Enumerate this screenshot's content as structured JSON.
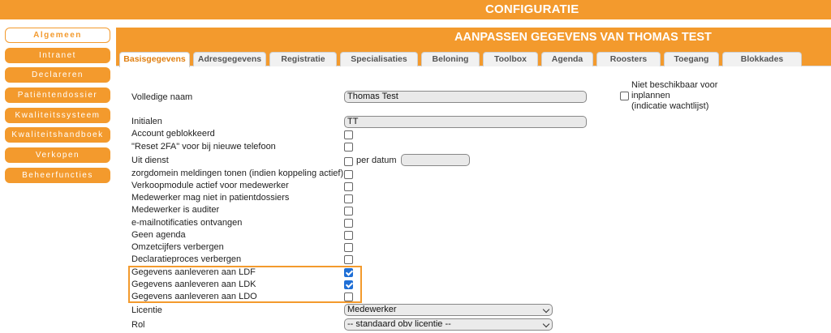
{
  "topbar": {
    "title": "CONFIGURATIE"
  },
  "sidebar": {
    "items": [
      {
        "label": "Algemeen",
        "active": true
      },
      {
        "label": "Intranet"
      },
      {
        "label": "Declareren"
      },
      {
        "label": "Patiëntendossier"
      },
      {
        "label": "Kwaliteitssysteem"
      },
      {
        "label": "Kwaliteitshandboek"
      },
      {
        "label": "Verkopen"
      },
      {
        "label": "Beheerfuncties"
      }
    ]
  },
  "header": {
    "title": "AANPASSEN GEGEVENS VAN THOMAS TEST"
  },
  "tabs": [
    {
      "label": "Basisgegevens",
      "active": true
    },
    {
      "label": "Adresgegevens"
    },
    {
      "label": "Registratie"
    },
    {
      "label": "Specialisaties"
    },
    {
      "label": "Beloning"
    },
    {
      "label": "Toolbox"
    },
    {
      "label": "Agenda"
    },
    {
      "label": "Roosters"
    },
    {
      "label": "Toegang"
    },
    {
      "label": "Blokkades"
    }
  ],
  "form": {
    "volledige_naam": {
      "label": "Volledige naam",
      "value": "Thomas Test"
    },
    "initialen": {
      "label": "Initialen",
      "value": "TT"
    },
    "not_available": {
      "label_1": "Niet beschikbaar voor",
      "label_2": "inplannen",
      "label_3": "(indicatie wachtlijst)",
      "checked": false
    },
    "uit_dienst": {
      "label": "Uit dienst",
      "per_datum_label": "per datum",
      "per_datum_value": ""
    },
    "checkboxes": [
      {
        "label": "Account geblokkeerd",
        "checked": false
      },
      {
        "label": "\"Reset 2FA\" voor bij nieuwe telefoon",
        "checked": false
      },
      {
        "label": "zorgdomein meldingen tonen (indien koppeling actief)",
        "checked": false
      },
      {
        "label": "Verkoopmodule actief voor medewerker",
        "checked": false
      },
      {
        "label": "Medewerker mag niet in patientdossiers",
        "checked": false
      },
      {
        "label": "Medewerker is auditer",
        "checked": false
      },
      {
        "label": "e-mailnotificaties ontvangen",
        "checked": false
      },
      {
        "label": "Geen agenda",
        "checked": false
      },
      {
        "label": "Omzetcijfers verbergen",
        "checked": false
      },
      {
        "label": "Declaratieproces verbergen",
        "checked": false
      },
      {
        "label": "Gegevens aanleveren aan LDF",
        "checked": true
      },
      {
        "label": "Gegevens aanleveren aan LDK",
        "checked": true
      },
      {
        "label": "Gegevens aanleveren aan LDO",
        "checked": false
      }
    ],
    "licentie": {
      "label": "Licentie",
      "value": "Medewerker"
    },
    "rol": {
      "label": "Rol",
      "value": "-- standaard obv licentie --"
    }
  },
  "colors": {
    "accent": "#f39a2d",
    "check": "#1f6fd6"
  }
}
